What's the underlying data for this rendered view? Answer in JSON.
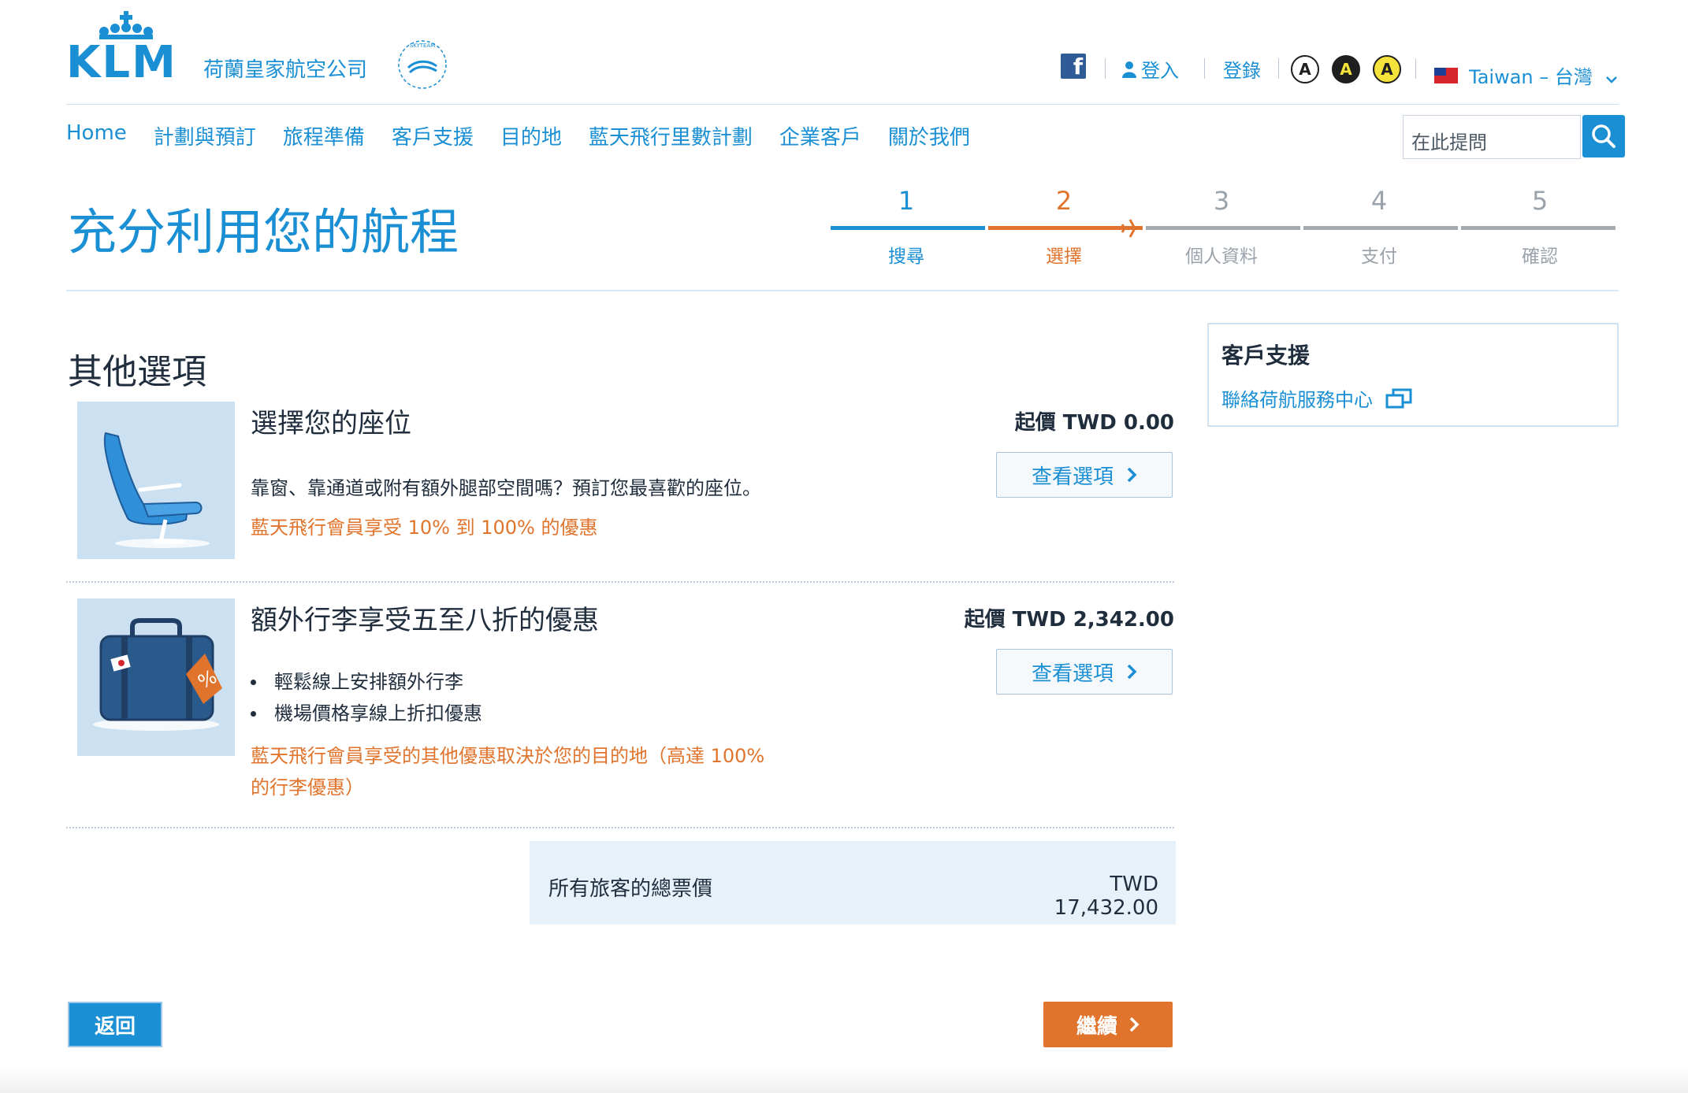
{
  "header": {
    "brand": "KLM",
    "brand_subtitle": "荷蘭皇家航空公司",
    "skyteam_label": "SKYTEAM",
    "facebook_label": "f",
    "login_label": "登入",
    "register_label": "登錄",
    "accessibility": [
      "A",
      "A",
      "A"
    ],
    "country_label": "Taiwan – 台灣"
  },
  "nav": {
    "items": [
      "Home",
      "計劃與預訂",
      "旅程準備",
      "客戶支援",
      "目的地",
      "藍天飛行里數計劃",
      "企業客戶",
      "關於我們"
    ],
    "search_placeholder": "在此提問"
  },
  "page": {
    "title": "充分利用您的航程"
  },
  "stepper": {
    "steps": [
      {
        "number": "1",
        "label": "搜尋",
        "state": "done"
      },
      {
        "number": "2",
        "label": "選擇",
        "state": "active"
      },
      {
        "number": "3",
        "label": "個人資料",
        "state": "todo"
      },
      {
        "number": "4",
        "label": "支付",
        "state": "todo"
      },
      {
        "number": "5",
        "label": "確認",
        "state": "todo"
      }
    ]
  },
  "options": {
    "section_title": "其他選項",
    "items": [
      {
        "title": "選擇您的座位",
        "description": "靠窗、靠通道或附有額外腿部空間嗎？預訂您最喜歡的座位。",
        "promo": "藍天飛行會員享受 10% 到 100% 的優惠",
        "price": "起價 TWD 0.00",
        "button": "查看選項"
      },
      {
        "title": "額外行李享受五至八折的優惠",
        "bullets": [
          "輕鬆線上安排額外行李",
          "機場價格享線上折扣優惠"
        ],
        "promo_line1": "藍天飛行會員享受的其他優惠取決於您的目的地（高達 100%",
        "promo_line2": "的行李優惠）",
        "price": "起價 TWD 2,342.00",
        "button": "查看選項"
      }
    ]
  },
  "total": {
    "label": "所有旅客的總票價",
    "value": "TWD 17,432.00"
  },
  "sidebar": {
    "title": "客戶支援",
    "link": "聯絡荷航服務中心"
  },
  "footer_buttons": {
    "back": "返回",
    "continue": "繼續"
  },
  "colors": {
    "brand_blue": "#1a8fd4",
    "accent_orange": "#e0742c",
    "text_dark": "#1f2d3d",
    "inactive_gray": "#a3abb2"
  }
}
